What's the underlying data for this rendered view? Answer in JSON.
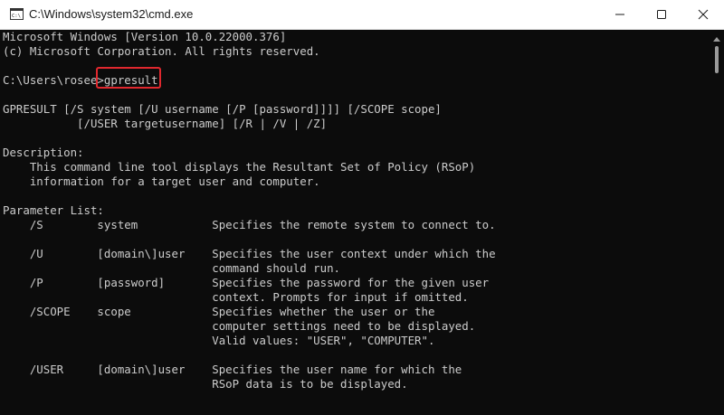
{
  "window": {
    "title": "C:\\Windows\\system32\\cmd.exe",
    "app_icon": "cmd-prompt-icon",
    "controls": {
      "minimize": "minimize-icon",
      "maximize": "maximize-icon",
      "close": "close-icon"
    }
  },
  "console": {
    "lines": {
      "l1": "Microsoft Windows [Version 10.0.22000.376]",
      "l2": "(c) Microsoft Corporation. All rights reserved.",
      "prompt": "C:\\Users\\rosee>",
      "command": "gpresult",
      "l6": "GPRESULT [/S system [/U username [/P [password]]]] [/SCOPE scope]",
      "l7": "           [/USER targetusername] [/R | /V | /Z]",
      "l9": "Description:",
      "l10": "    This command line tool displays the Resultant Set of Policy (RSoP)",
      "l11": "    information for a target user and computer.",
      "l13": "Parameter List:",
      "l14": "    /S        system           Specifies the remote system to connect to.",
      "l16": "    /U        [domain\\]user    Specifies the user context under which the",
      "l17": "                               command should run.",
      "l18": "    /P        [password]       Specifies the password for the given user",
      "l19": "                               context. Prompts for input if omitted.",
      "l20": "    /SCOPE    scope            Specifies whether the user or the",
      "l21": "                               computer settings need to be displayed.",
      "l22": "                               Valid values: \"USER\", \"COMPUTER\".",
      "l25": "    /USER     [domain\\]user    Specifies the user name for which the",
      "l26": "                               RSoP data is to be displayed."
    },
    "highlight_color": "#e0282e"
  },
  "scrollbar": {
    "up_arrow": "scroll-up-arrow-icon"
  }
}
